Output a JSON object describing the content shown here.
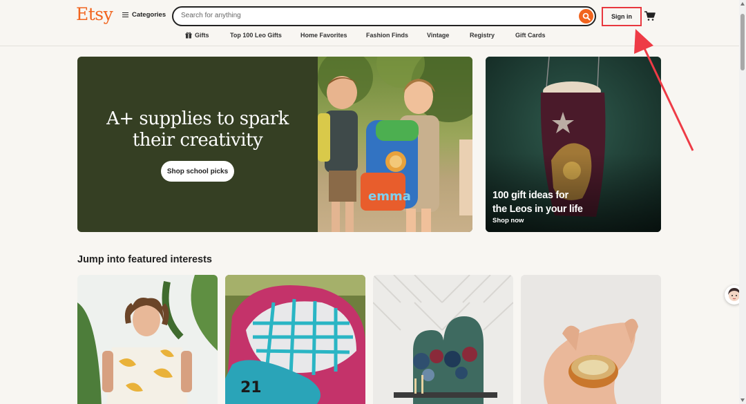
{
  "colors": {
    "brand": "#f1641e",
    "hero_bg": "#353f23",
    "highlight": "#e8373e"
  },
  "header": {
    "logo": "Etsy",
    "categories_label": "Categories",
    "search_placeholder": "Search for anything",
    "signin_label": "Sign in",
    "icons": [
      "menu-icon",
      "search-icon",
      "cart-icon",
      "gift-icon"
    ]
  },
  "nav": {
    "items": [
      {
        "label": "Gifts",
        "icon": "gift-icon"
      },
      {
        "label": "Top 100 Leo Gifts"
      },
      {
        "label": "Home Favorites"
      },
      {
        "label": "Fashion Finds"
      },
      {
        "label": "Vintage"
      },
      {
        "label": "Registry"
      },
      {
        "label": "Gift Cards"
      }
    ]
  },
  "hero": {
    "title_line1": "A+ supplies to spark",
    "title_line2": "their creativity",
    "button_label": "Shop school picks",
    "backpack_text": "emma"
  },
  "promo": {
    "title_line1": "100 gift ideas for",
    "title_line2": "the Leos in your life",
    "link_label": "Shop now"
  },
  "featured": {
    "title": "Jump into featured interests",
    "baseball_glove_number": "21"
  }
}
